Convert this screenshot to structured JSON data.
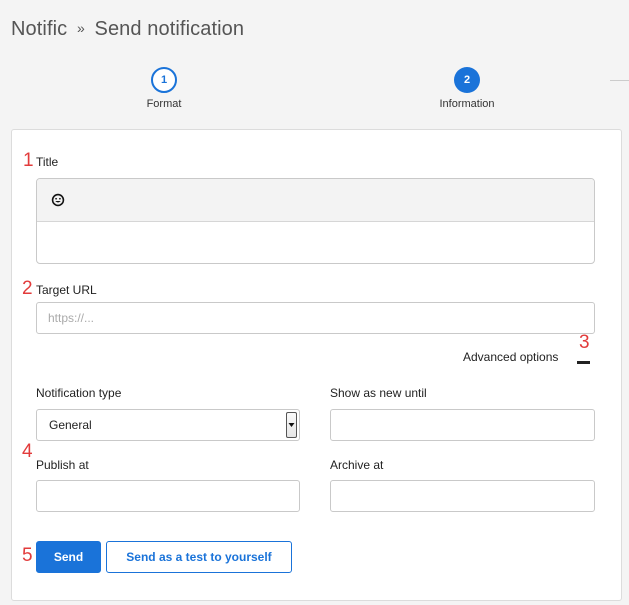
{
  "header": {
    "app": "Notific",
    "separator": "»",
    "page": "Send notification"
  },
  "steps": [
    {
      "number": "1",
      "label": "Format"
    },
    {
      "number": "2",
      "label": "Information"
    }
  ],
  "markers": [
    "1",
    "2",
    "3",
    "4",
    "5"
  ],
  "form": {
    "title_label": "Title",
    "emoji_icon": "smiley-emoji-icon",
    "target_url_label": "Target URL",
    "target_url_placeholder": "https://...",
    "advanced_options": "Advanced options",
    "notification_type_label": "Notification type",
    "notification_type_value": "General",
    "show_as_new_until_label": "Show as new until",
    "publish_at_label": "Publish at",
    "archive_at_label": "Archive at"
  },
  "actions": {
    "send": "Send",
    "send_test": "Send as a test to yourself"
  },
  "colors": {
    "accent": "#1a73d9",
    "marker": "#e23b3b"
  }
}
